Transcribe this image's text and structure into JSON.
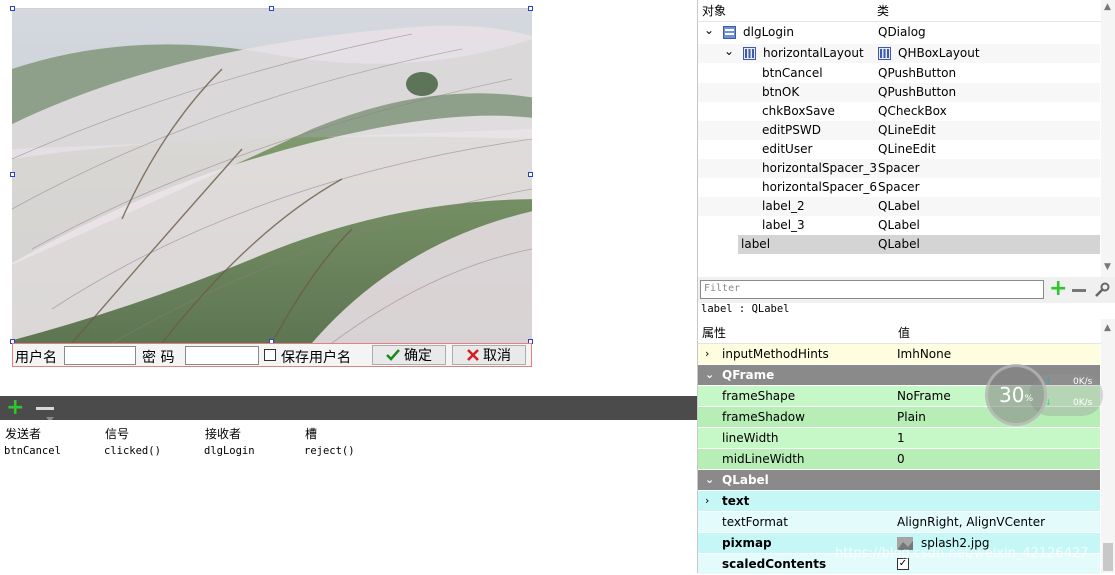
{
  "login_form": {
    "username_label": "用户名",
    "password_label": "密  码",
    "save_user_label": "保存用户名",
    "ok_label": "确定",
    "cancel_label": "取消"
  },
  "signal_slot": {
    "headers": [
      "发送者",
      "信号",
      "接收者",
      "槽"
    ],
    "rows": [
      [
        "btnCancel",
        "clicked()",
        "dlgLogin",
        "reject()"
      ]
    ]
  },
  "object_inspector": {
    "col_object": "对象",
    "col_class": "类",
    "items": [
      {
        "name": "dlgLogin",
        "cls": "QDialog"
      },
      {
        "name": "horizontalLayout",
        "cls": "QHBoxLayout"
      },
      {
        "name": "btnCancel",
        "cls": "QPushButton"
      },
      {
        "name": "btnOK",
        "cls": "QPushButton"
      },
      {
        "name": "chkBoxSave",
        "cls": "QCheckBox"
      },
      {
        "name": "editPSWD",
        "cls": "QLineEdit"
      },
      {
        "name": "editUser",
        "cls": "QLineEdit"
      },
      {
        "name": "horizontalSpacer_3",
        "cls": "Spacer"
      },
      {
        "name": "horizontalSpacer_6",
        "cls": "Spacer"
      },
      {
        "name": "label_2",
        "cls": "QLabel"
      },
      {
        "name": "label_3",
        "cls": "QLabel"
      },
      {
        "name": "label",
        "cls": "QLabel"
      }
    ]
  },
  "property_editor": {
    "filter_placeholder": "Filter",
    "current_object": "label : QLabel",
    "col_property": "属性",
    "col_value": "值",
    "rows": [
      {
        "name": "inputMethodHints",
        "value": "ImhNone"
      },
      {
        "name": "QFrame",
        "value": ""
      },
      {
        "name": "frameShape",
        "value": "NoFrame"
      },
      {
        "name": "frameShadow",
        "value": "Plain"
      },
      {
        "name": "lineWidth",
        "value": "1"
      },
      {
        "name": "midLineWidth",
        "value": "0"
      },
      {
        "name": "QLabel",
        "value": ""
      },
      {
        "name": "text",
        "value": ""
      },
      {
        "name": "textFormat",
        "value": "AlignRight, AlignVCenter"
      },
      {
        "name": "pixmap",
        "value": "splash2.jpg"
      },
      {
        "name": "scaledContents",
        "value": ""
      }
    ]
  },
  "net_monitor": {
    "percent": "30",
    "unit": "%",
    "up": "0K/s",
    "down": "0K/s"
  },
  "watermark": "https://blog.csdn.net/weixin_42126427",
  "colors": {
    "toolbar_dark": "#4b4b4b",
    "section_gray": "#8a8a8a",
    "qframe_green": "#c6f7c6",
    "qlabel_cyan": "#c6f7f7",
    "widget_yellow": "#fffde0",
    "selected_row": "#d4d4d4"
  }
}
